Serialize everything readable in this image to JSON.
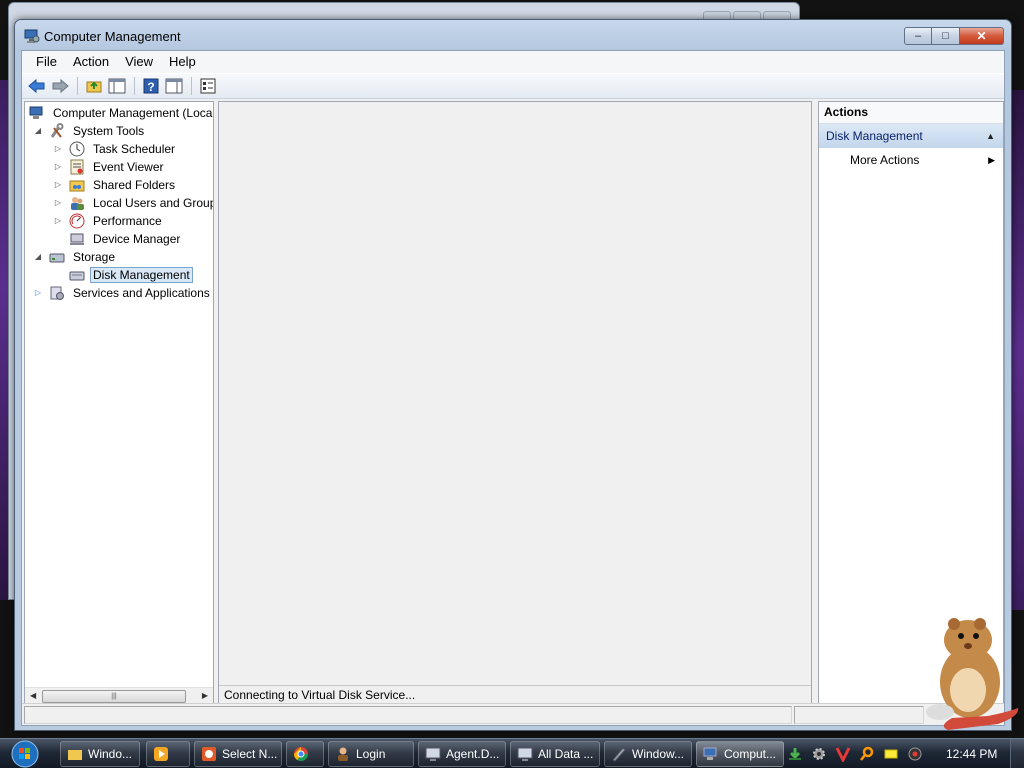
{
  "window": {
    "title": "Computer Management",
    "controls": {
      "minimize": "–",
      "maximize": "□",
      "close": "✕"
    }
  },
  "menu": [
    "File",
    "Action",
    "View",
    "Help"
  ],
  "toolbar": [
    "back-icon",
    "forward-icon",
    "up-folder-icon",
    "show-hide-tree-icon",
    "help-icon",
    "show-hide-action-pane-icon",
    "properties-icon"
  ],
  "tree": {
    "root": "Computer Management (Local",
    "system_tools": "System Tools",
    "task_scheduler": "Task Scheduler",
    "event_viewer": "Event Viewer",
    "shared_folders": "Shared Folders",
    "local_users": "Local Users and Groups",
    "performance": "Performance",
    "device_manager": "Device Manager",
    "storage": "Storage",
    "disk_management": "Disk Management",
    "services_apps": "Services and Applications"
  },
  "middle": {
    "status": "Connecting to Virtual Disk Service..."
  },
  "actions": {
    "header": "Actions",
    "group": "Disk Management",
    "more_actions": "More Actions"
  },
  "taskbar": {
    "items": [
      "Windo...",
      "",
      "Select N...",
      "",
      "Login",
      "Agent.D...",
      "All Data ...",
      "Window...",
      "Comput..."
    ],
    "clock": "12:44 PM"
  },
  "colors": {
    "accent": "#0a246a",
    "selection": "#d9e8f7",
    "close_button": "#c2391d"
  }
}
